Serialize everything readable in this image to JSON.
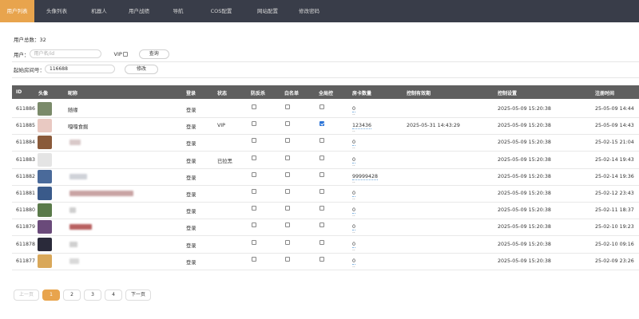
{
  "nav": {
    "items": [
      {
        "label": "用户列表",
        "active": true
      },
      {
        "label": "头像列表",
        "active": false
      },
      {
        "label": "机器人",
        "active": false
      },
      {
        "label": "用户战绩",
        "active": false
      },
      {
        "label": "导航",
        "active": false
      },
      {
        "label": "COS配置",
        "active": false
      },
      {
        "label": "网站配置",
        "active": false
      },
      {
        "label": "修改密码",
        "active": false
      }
    ],
    "accent": "#e8a44d",
    "background": "#393d49"
  },
  "stats": {
    "total_label": "用户总数：",
    "total_value": "32"
  },
  "filter": {
    "user_label": "用户：",
    "user_placeholder": "用户名/id",
    "vip_label": "VIP",
    "query_button": "查询",
    "start_room_label": "起始房间号：",
    "start_room_value": "116688",
    "modify_button": "修改"
  },
  "table": {
    "headers": {
      "id": "ID",
      "avatar": "头像",
      "nickname": "昵称",
      "login": "登录",
      "status": "状态",
      "anti_cheat": "防反杀",
      "whitelist": "白名单",
      "full_control": "全局控",
      "cards": "房卡数量",
      "control_expiry": "控制有效期",
      "control_set": "控制设置",
      "register_time": "注册时间"
    },
    "rows": [
      {
        "id": "611886",
        "nickname": "随缘",
        "login": "登录",
        "status": "",
        "anti_cheat": false,
        "whitelist": false,
        "full_control": false,
        "cards": "0",
        "control_expiry": "",
        "control_set": "2025-05-09 15:20:38",
        "register_time": "25-05-09 14:44",
        "avatar_color": "#7a8a6a"
      },
      {
        "id": "611885",
        "nickname": "嘎嘎食掘",
        "login": "登录",
        "status": "VIP",
        "anti_cheat": false,
        "whitelist": false,
        "full_control": true,
        "cards": "123436",
        "control_expiry": "2025-05-31 14:43:29",
        "control_set": "2025-05-09 15:20:38",
        "register_time": "25-05-09 14:43",
        "avatar_color": "#e9c9c2"
      },
      {
        "id": "611884",
        "nickname": "",
        "login": "登录",
        "status": "",
        "anti_cheat": false,
        "whitelist": false,
        "full_control": false,
        "cards": "0",
        "control_expiry": "",
        "control_set": "2025-05-09 15:20:38",
        "register_time": "25-02-15 21:04",
        "avatar_color": "#8a5a3a"
      },
      {
        "id": "611883",
        "nickname": "",
        "login": "登录",
        "status": "已拉黑",
        "anti_cheat": false,
        "whitelist": false,
        "full_control": false,
        "cards": "0",
        "control_expiry": "",
        "control_set": "2025-05-09 15:20:38",
        "register_time": "25-02-14 19:43",
        "avatar_color": "#e4e4e4"
      },
      {
        "id": "611882",
        "nickname": "",
        "login": "登录",
        "status": "",
        "anti_cheat": false,
        "whitelist": false,
        "full_control": false,
        "cards": "99999428",
        "control_expiry": "",
        "control_set": "2025-05-09 15:20:38",
        "register_time": "25-02-14 19:36",
        "avatar_color": "#4a6a9a"
      },
      {
        "id": "611881",
        "nickname": "",
        "login": "登录",
        "status": "",
        "anti_cheat": false,
        "whitelist": false,
        "full_control": false,
        "cards": "0",
        "control_expiry": "",
        "control_set": "2025-05-09 15:20:38",
        "register_time": "25-02-12 23:43",
        "avatar_color": "#3a5a8a"
      },
      {
        "id": "611880",
        "nickname": "",
        "login": "登录",
        "status": "",
        "anti_cheat": false,
        "whitelist": false,
        "full_control": false,
        "cards": "0",
        "control_expiry": "",
        "control_set": "2025-05-09 15:20:38",
        "register_time": "25-02-11 18:37",
        "avatar_color": "#5a7a4a"
      },
      {
        "id": "611879",
        "nickname": "",
        "login": "登录",
        "status": "",
        "anti_cheat": false,
        "whitelist": false,
        "full_control": false,
        "cards": "0",
        "control_expiry": "",
        "control_set": "2025-05-09 15:20:38",
        "register_time": "25-02-10 19:23",
        "avatar_color": "#6a4a7a"
      },
      {
        "id": "611878",
        "nickname": "",
        "login": "登录",
        "status": "",
        "anti_cheat": false,
        "whitelist": false,
        "full_control": false,
        "cards": "0",
        "control_expiry": "",
        "control_set": "2025-05-09 15:20:38",
        "register_time": "25-02-10 09:16",
        "avatar_color": "#2a2a3a"
      },
      {
        "id": "611877",
        "nickname": "",
        "login": "登录",
        "status": "",
        "anti_cheat": false,
        "whitelist": false,
        "full_control": false,
        "cards": "0",
        "control_expiry": "",
        "control_set": "2025-05-09 15:20:38",
        "register_time": "25-02-09 23:26",
        "avatar_color": "#d9a85a"
      }
    ]
  },
  "pagination": {
    "prev": "上一页",
    "pages": [
      "1",
      "2",
      "3",
      "4"
    ],
    "current": "1",
    "next": "下一页"
  }
}
